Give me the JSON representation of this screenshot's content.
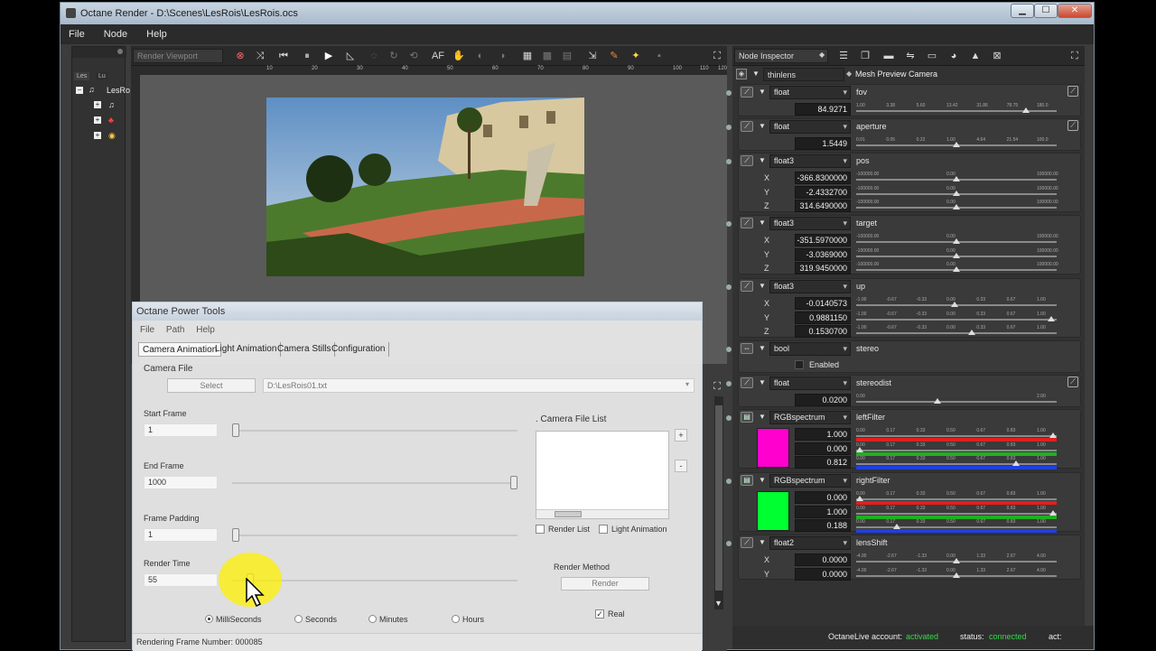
{
  "window": {
    "title": "Octane Render - D:\\Scenes\\LesRois\\LesRois.ocs",
    "controls": {
      "minimize": "▁",
      "maximize": "☐",
      "close": "✕"
    }
  },
  "menubar": {
    "items": [
      "File",
      "Node",
      "Help"
    ]
  },
  "left_panel": {
    "tabs": [
      "Les",
      "Lu"
    ],
    "tree_root": "LesRo"
  },
  "render_viewport": {
    "label": "Render Viewport",
    "toolbar_icons": [
      "stop-icon",
      "reset-icon",
      "rewind-icon",
      "pause-icon",
      "play-icon",
      "focus-icon",
      "afr-icon",
      "refresh-icon",
      "rotate-icon",
      "af-label",
      "camera-icon",
      "pick-icon",
      "pick-icon2",
      "grid-icon",
      "grid2-icon",
      "grid3-icon",
      "export-icon",
      "color-icon",
      "star-icon",
      "lock-icon",
      "expand-icon"
    ],
    "af_label": "AF",
    "ruler_ticks": [
      "10",
      "20",
      "30",
      "40",
      "50",
      "60",
      "70",
      "80",
      "90",
      "100",
      "110",
      "120"
    ]
  },
  "node_inspector": {
    "label": "Node Inspector",
    "node_type": "thinlens",
    "node_name": "Mesh Preview Camera",
    "params": [
      {
        "type": "float",
        "name": "fov",
        "values": [
          "84.9271"
        ],
        "ticks": [
          "1.00",
          "3.38",
          "5.60",
          "13.42",
          "31.86",
          "78.75",
          "180.0"
        ],
        "knobs": [
          0.86
        ]
      },
      {
        "type": "float",
        "name": "aperture",
        "values": [
          "1.5449"
        ],
        "ticks": [
          "0.01",
          "0.05",
          "0.22",
          "1.00",
          "4.64",
          "21.54",
          "100.0"
        ],
        "knobs": [
          0.5
        ]
      },
      {
        "type": "float3",
        "name": "pos",
        "axes": [
          "X",
          "Y",
          "Z"
        ],
        "values": [
          "-366.8300000",
          "-2.4332700",
          "314.6490000"
        ],
        "ticks": [
          "-100000.00",
          "0.00",
          "100000.00"
        ],
        "knobs": [
          0.5,
          0.5,
          0.5
        ]
      },
      {
        "type": "float3",
        "name": "target",
        "axes": [
          "X",
          "Y",
          "Z"
        ],
        "values": [
          "-351.5970000",
          "-3.0369000",
          "319.9450000"
        ],
        "ticks": [
          "-100000.00",
          "0.00",
          "100000.00"
        ],
        "knobs": [
          0.5,
          0.5,
          0.5
        ]
      },
      {
        "type": "float3",
        "name": "up",
        "axes": [
          "X",
          "Y",
          "Z"
        ],
        "values": [
          "-0.0140573",
          "0.9881150",
          "0.1530700"
        ],
        "ticks": [
          "-1.00",
          "-0.67",
          "-0.33",
          "0.00",
          "0.33",
          "0.67",
          "1.00"
        ],
        "knobs": [
          0.49,
          0.99,
          0.58
        ]
      },
      {
        "type": "bool",
        "name": "stereo",
        "check_label": "Enabled"
      },
      {
        "type": "float",
        "name": "stereodist",
        "values": [
          "0.0200"
        ],
        "ticks": [
          "0.00",
          "2.00"
        ],
        "knobs": [
          0.4
        ]
      },
      {
        "type": "RGBspectrum",
        "name": "leftFilter",
        "values": [
          "1.000",
          "0.000",
          "0.812"
        ],
        "ticks": [
          "0.00",
          "0.17",
          "0.33",
          "0.50",
          "0.67",
          "0.83",
          "1.00"
        ],
        "knobs": [
          1.0,
          0.0,
          0.81
        ],
        "swatch": "#ff00cf"
      },
      {
        "type": "RGBspectrum",
        "name": "rightFilter",
        "values": [
          "0.000",
          "1.000",
          "0.188"
        ],
        "ticks": [
          "0.00",
          "0.17",
          "0.33",
          "0.50",
          "0.67",
          "0.83",
          "1.00"
        ],
        "knobs": [
          0.0,
          1.0,
          0.19
        ],
        "swatch": "#00ff30"
      },
      {
        "type": "float2",
        "name": "lensShift",
        "axes": [
          "X",
          "Y"
        ],
        "values": [
          "0.0000",
          "0.0000"
        ],
        "ticks": [
          "-4.00",
          "-2.67",
          "-1.33",
          "0.00",
          "1.33",
          "2.67",
          "4.00"
        ],
        "knobs": [
          0.5,
          0.5
        ]
      }
    ]
  },
  "status_bar": {
    "account_label": "OctaneLive account:",
    "account_value": "activated",
    "status_label": "status:",
    "status_value": "connected",
    "act_label": "act:"
  },
  "power_tools": {
    "title": "Octane Power Tools",
    "menu": [
      "File",
      "Path",
      "Help"
    ],
    "tabs": [
      "Camera Animation",
      "Light Animation",
      "Camera Stills",
      "Configuration"
    ],
    "camera_file_label": "Camera File",
    "select_button": "Select",
    "camera_file_path": "D:\\LesRois01.txt",
    "start_frame_label": "Start Frame",
    "start_frame_value": "1",
    "end_frame_label": "End Frame",
    "end_frame_value": "1000",
    "frame_padding_label": "Frame Padding",
    "frame_padding_value": "1",
    "render_time_label": "Render Time",
    "render_time_value": "55",
    "camera_file_list_label": ". Camera File List",
    "add_button": "+",
    "remove_button": "-",
    "render_list_label": "Render List",
    "light_animation_label": "Light Animation",
    "render_method_label": "Render Method",
    "render_button": "Render",
    "time_units": [
      "MilliSeconds",
      "Seconds",
      "Minutes",
      "Hours"
    ],
    "time_unit_selected": 0,
    "real_label": "Real",
    "rendering_status": "Rendering Frame Number: 000085"
  },
  "colors": {
    "activated": "#38d84a",
    "connected": "#38d84a",
    "red_bar": "#e02020",
    "green_bar": "#20b020",
    "blue_bar": "#2040e0"
  }
}
